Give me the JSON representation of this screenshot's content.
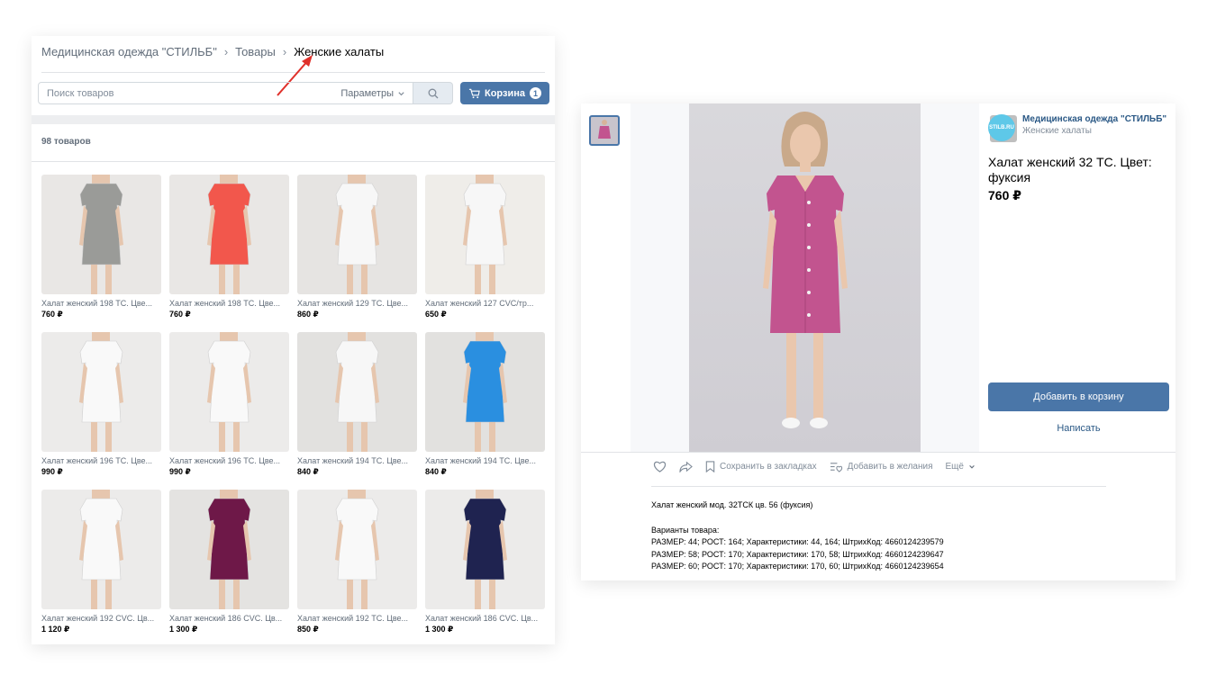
{
  "catalog": {
    "breadcrumb": [
      "Медицинская одежда \"СТИЛЬБ\"",
      "Товары",
      "Женские халаты"
    ],
    "search": {
      "placeholder": "Поиск товаров",
      "params_label": "Параметры"
    },
    "cart": {
      "label": "Корзина",
      "count": "1"
    },
    "count_label": "98 товаров",
    "products": [
      {
        "title": "Халат женский 198 ТС. Цве...",
        "price": "760 ₽",
        "color": "#9a9b98",
        "bg": "#e9e7e5"
      },
      {
        "title": "Халат женский 198 ТС. Цве...",
        "price": "760 ₽",
        "color": "#f2574c",
        "bg": "#e9e7e5"
      },
      {
        "title": "Халат женский 129 ТС. Цве...",
        "price": "860 ₽",
        "color": "#f7f7f7",
        "bg": "#e6e4e2"
      },
      {
        "title": "Халат женский 127 CVC/тр...",
        "price": "650 ₽",
        "color": "#f7f7f7",
        "bg": "#efede9"
      },
      {
        "title": "Халат женский 196 ТС. Цве...",
        "price": "990 ₽",
        "color": "#f9f9f9",
        "bg": "#ecebea"
      },
      {
        "title": "Халат женский 196 ТС. Цве...",
        "price": "990 ₽",
        "color": "#f9f9f9",
        "bg": "#ecebea"
      },
      {
        "title": "Халат женский 194 ТС. Цве...",
        "price": "840 ₽",
        "color": "#f7f7f7",
        "bg": "#e2e1df"
      },
      {
        "title": "Халат женский 194 ТС. Цве...",
        "price": "840 ₽",
        "color": "#2a8fe0",
        "bg": "#e2e1df"
      },
      {
        "title": "Халат женский 192 CVC. Цв...",
        "price": "1 120 ₽",
        "color": "#f9f9f9",
        "bg": "#ecebea"
      },
      {
        "title": "Халат женский 186 CVC. Цв...",
        "price": "1 300 ₽",
        "color": "#6e1848",
        "bg": "#e4e3e1"
      },
      {
        "title": "Халат женский 192 ТС. Цве...",
        "price": "850 ₽",
        "color": "#f9f9f9",
        "bg": "#ecebea"
      },
      {
        "title": "Халат женский 186 CVC. Цв...",
        "price": "1 300 ₽",
        "color": "#1f2350",
        "bg": "#ecebea"
      }
    ]
  },
  "product": {
    "store_name": "Медицинская одежда \"СТИЛЬБ\"",
    "store_logo_text": "STILB.RU",
    "category": "Женские халаты",
    "title": "Халат женский 32 ТС. Цвет: фуксия",
    "price": "760 ₽",
    "dress_color": "#c2548f",
    "add_to_cart": "Добавить в корзину",
    "write": "Написать",
    "actions": {
      "bookmark": "Сохранить в закладках",
      "wishlist": "Добавить в желания",
      "more": "Ещё"
    },
    "description": "Халат женский мод. 32ТСК цв. 56 (фуксия)",
    "variants_title": "Варианты товара:",
    "variants": [
      "РАЗМЕР: 44; РОСТ: 164; Характеристики: 44, 164; ШтрихКод: 4660124239579",
      "РАЗМЕР: 58; РОСТ: 170; Характеристики: 170, 58; ШтрихКод: 4660124239647",
      "РАЗМЕР: 60; РОСТ: 170; Характеристики: 170, 60; ШтрихКод: 4660124239654"
    ]
  }
}
